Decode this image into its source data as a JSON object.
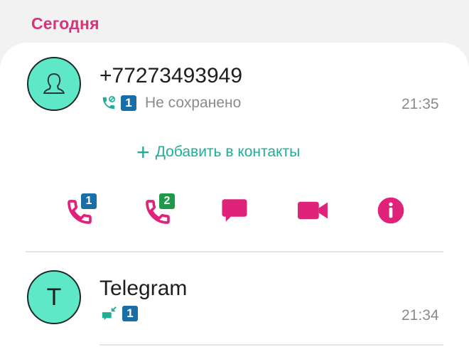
{
  "section": {
    "title": "Сегодня"
  },
  "colors": {
    "accent": "#e0237a",
    "teal": "#1fae96",
    "avatar": "#5fe8c8",
    "sim1": "#1a6ea8",
    "sim2": "#1f9a4a"
  },
  "calls": [
    {
      "name": "+77273493949",
      "avatar_icon": "person-icon",
      "call_type_icon": "missed-call-icon",
      "sim": "1",
      "status": "Не сохранено",
      "time": "21:35"
    },
    {
      "name": "Telegram",
      "avatar_letter": "T",
      "call_type_icon": "incoming-message-icon",
      "sim": "1",
      "status": "",
      "time": "21:34"
    }
  ],
  "expanded": {
    "add_contact_label": "Добавить в контакты",
    "actions": [
      {
        "name": "call-sim1",
        "icon": "phone-icon",
        "badge": "1"
      },
      {
        "name": "call-sim2",
        "icon": "phone-icon",
        "badge": "2"
      },
      {
        "name": "message",
        "icon": "message-icon"
      },
      {
        "name": "video-call",
        "icon": "video-icon"
      },
      {
        "name": "info",
        "icon": "info-icon"
      }
    ]
  }
}
